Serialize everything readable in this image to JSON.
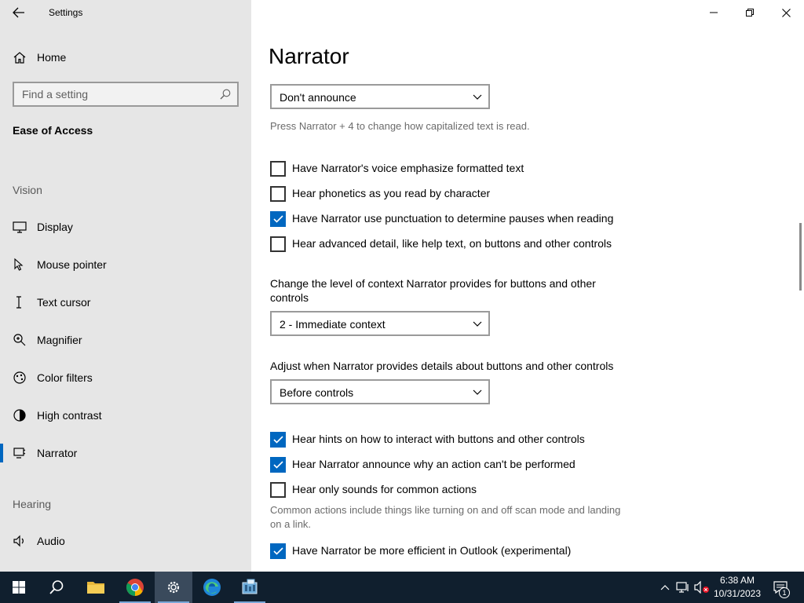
{
  "window": {
    "title": "Settings",
    "back_icon": "back-arrow-icon",
    "controls": [
      "minimize",
      "restore",
      "close"
    ]
  },
  "nav": {
    "home_label": "Home",
    "search_placeholder": "Find a setting",
    "section_title": "Ease of Access",
    "groups": [
      {
        "label": "Vision"
      },
      {
        "label": "Hearing"
      }
    ],
    "items": [
      {
        "label": "Display",
        "icon": "monitor-icon"
      },
      {
        "label": "Mouse pointer",
        "icon": "mouse-pointer-icon"
      },
      {
        "label": "Text cursor",
        "icon": "text-cursor-icon"
      },
      {
        "label": "Magnifier",
        "icon": "magnifier-icon"
      },
      {
        "label": "Color filters",
        "icon": "color-filters-icon"
      },
      {
        "label": "High contrast",
        "icon": "high-contrast-icon"
      },
      {
        "label": "Narrator",
        "icon": "narrator-icon",
        "selected": true
      },
      {
        "label": "Audio",
        "icon": "audio-icon"
      }
    ]
  },
  "main": {
    "title": "Narrator",
    "capitalization_dropdown": "Don't announce",
    "capitalization_help": "Press Narrator + 4 to change how capitalized text is read.",
    "checkboxes_a": [
      {
        "label": "Have Narrator's voice emphasize formatted text",
        "checked": false
      },
      {
        "label": "Hear phonetics as you read by character",
        "checked": false
      },
      {
        "label": "Have Narrator use punctuation to determine pauses when reading",
        "checked": true
      },
      {
        "label": "Hear advanced detail, like help text, on buttons and other controls",
        "checked": false
      }
    ],
    "context_label": "Change the level of context Narrator provides for buttons and other controls",
    "context_dropdown": "2 - Immediate context",
    "details_label": "Adjust when Narrator provides details about buttons and other controls",
    "details_dropdown": "Before controls",
    "checkboxes_b": [
      {
        "label": "Hear hints on how to interact with buttons and other controls",
        "checked": true
      },
      {
        "label": "Hear Narrator announce why an action can't be performed",
        "checked": true
      },
      {
        "label": "Hear only sounds for common actions",
        "checked": false
      }
    ],
    "sounds_help": "Common actions include things like turning on and off scan mode and landing on a link.",
    "checkbox_outlook": {
      "label": "Have Narrator be more efficient in Outlook (experimental)",
      "checked": true
    }
  },
  "taskbar": {
    "time": "6:38 AM",
    "date": "10/31/2023",
    "notification_count": "1",
    "apps": [
      "start-icon",
      "search-icon",
      "file-explorer-icon",
      "chrome-icon",
      "settings-icon",
      "edge-icon",
      "control-panel-icon"
    ]
  },
  "colors": {
    "accent": "#0067c0",
    "nav_bg": "#e6e6e6",
    "taskbar_bg": "#101f2e"
  }
}
